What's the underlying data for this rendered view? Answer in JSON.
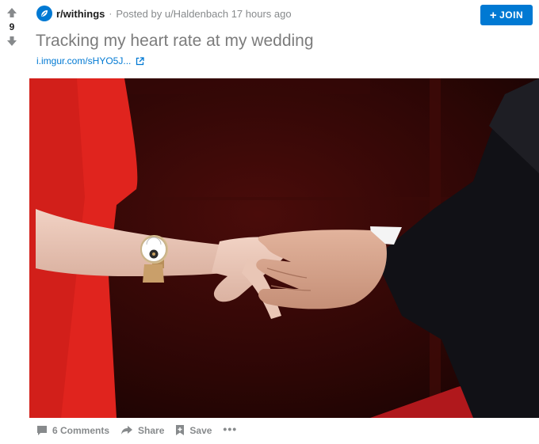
{
  "colors": {
    "accent": "#0079d3",
    "muted": "#878a8c",
    "title": "#7c7c7c"
  },
  "vote": {
    "count": "9",
    "up_icon": "upvote-arrow-icon",
    "down_icon": "downvote-arrow-icon"
  },
  "header": {
    "subreddit": "r/withings",
    "separator": "·",
    "posted_prefix": "Posted by",
    "user": "u/Haldenbach",
    "time": "17 hours ago",
    "join_plus": "+",
    "join_label": "JOIN"
  },
  "post": {
    "title": "Tracking my heart rate at my wedding",
    "link_text": "i.imgur.com/sHYO5J...",
    "link_icon": "external-link-icon"
  },
  "image": {
    "subject": "photo of two people holding hands, woman wearing an analog smartwatch, red dress and dark suit"
  },
  "actions": {
    "comments": "6 Comments",
    "share": "Share",
    "save": "Save",
    "more": "•••"
  }
}
